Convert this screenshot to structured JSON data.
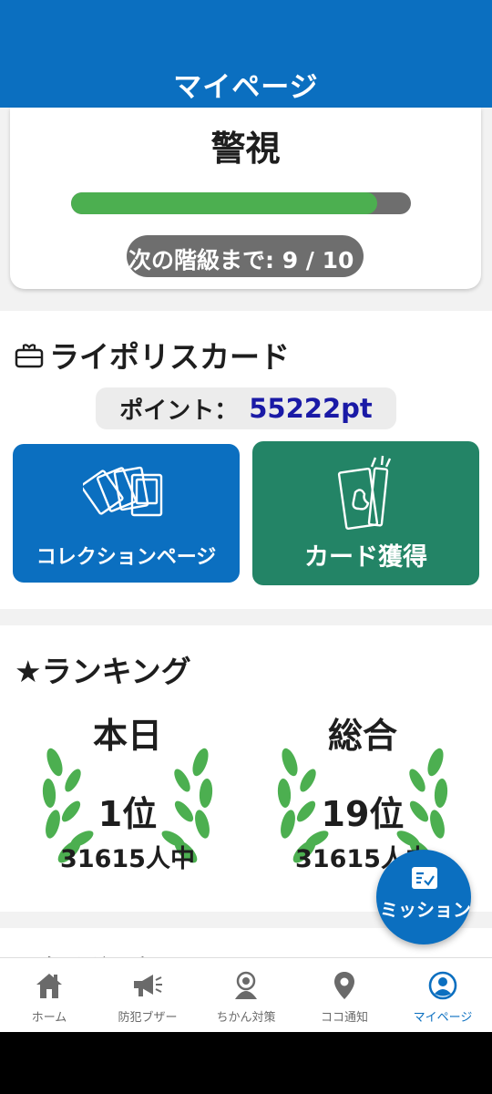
{
  "colors": {
    "primary": "#0b6fc0",
    "accent_green": "#238466",
    "progress_green": "#4caf50",
    "points_blue": "#1a1aa6"
  },
  "header": {
    "title": "マイページ"
  },
  "rank": {
    "title": "警視",
    "progress": {
      "current": 9,
      "total": 10
    },
    "next_rank_text": "次の階級まで: 9 / 10"
  },
  "card_section": {
    "title": "ライポリスカード",
    "points_label": "ポイント：",
    "points_value": "55222pt",
    "tiles": [
      {
        "label": "コレクションページ",
        "icon": "cards-collection-icon"
      },
      {
        "label": "カード獲得",
        "icon": "card-pack-icon"
      }
    ]
  },
  "ranking_section": {
    "title": "★ランキング",
    "today": {
      "label": "本日",
      "place": "1位",
      "count": "31615人中"
    },
    "total": {
      "label": "総合",
      "place": "19位",
      "count": "31615人中"
    }
  },
  "next_section": {
    "title": "◆各種設定"
  },
  "mission_button": {
    "label": "ミッション",
    "icon": "checklist-icon"
  },
  "bottom_nav": [
    {
      "label": "ホーム",
      "icon": "home-icon"
    },
    {
      "label": "防犯ブザー",
      "icon": "megaphone-icon"
    },
    {
      "label": "ちかん対策",
      "icon": "shield-person-icon"
    },
    {
      "label": "ココ通知",
      "icon": "location-pin-icon"
    },
    {
      "label": "マイページ",
      "icon": "account-circle-icon",
      "active": true
    }
  ]
}
